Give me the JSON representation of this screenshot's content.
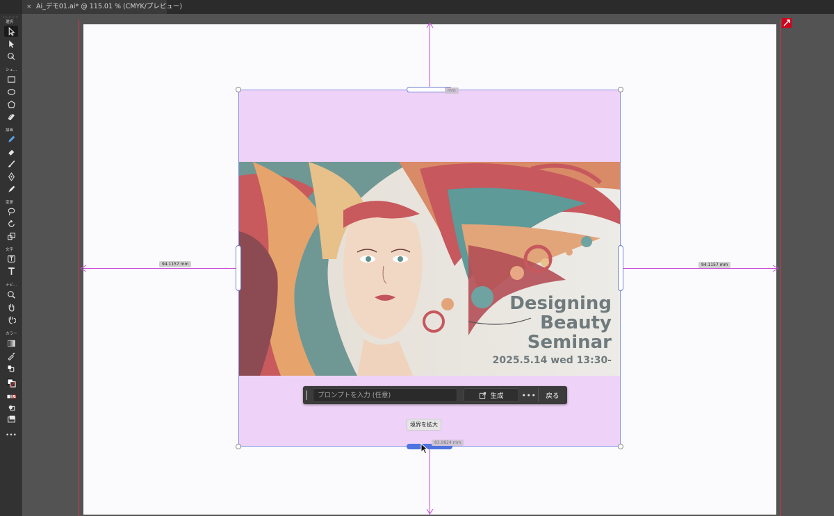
{
  "tab": {
    "close": "×",
    "title": "Ai_デモ01.ai* @ 115.01 % (CMYK/プレビュー)"
  },
  "toolbar": {
    "groups": {
      "select": "選択",
      "shape": "シェ…",
      "draw": "描画",
      "modify": "変更",
      "type": "文字",
      "navigate": "ナビ…",
      "color": "カラー"
    },
    "more": "•••"
  },
  "artwork": {
    "line1": "Designing",
    "line2": "Beauty",
    "line3": "Seminar",
    "date": "2025.5.14 wed 13:30-"
  },
  "measurements": {
    "left": "94.1157 mm",
    "right": "94.1157 mm",
    "top": "mm",
    "bottom": "83.9824 mm"
  },
  "taskbar": {
    "prompt_placeholder": "プロンプトを入力 (任意)",
    "generate_label": "生成",
    "more_label": "•••",
    "back_label": "戻る"
  },
  "tooltip": {
    "expand_bounds": "境界を拡大"
  },
  "colors": {
    "fill_band": "#efd2f7",
    "guide": "#c84bd6",
    "selection": "#7f8fe6",
    "active_handle": "#4f73df",
    "bleed": "#d23a4a"
  }
}
